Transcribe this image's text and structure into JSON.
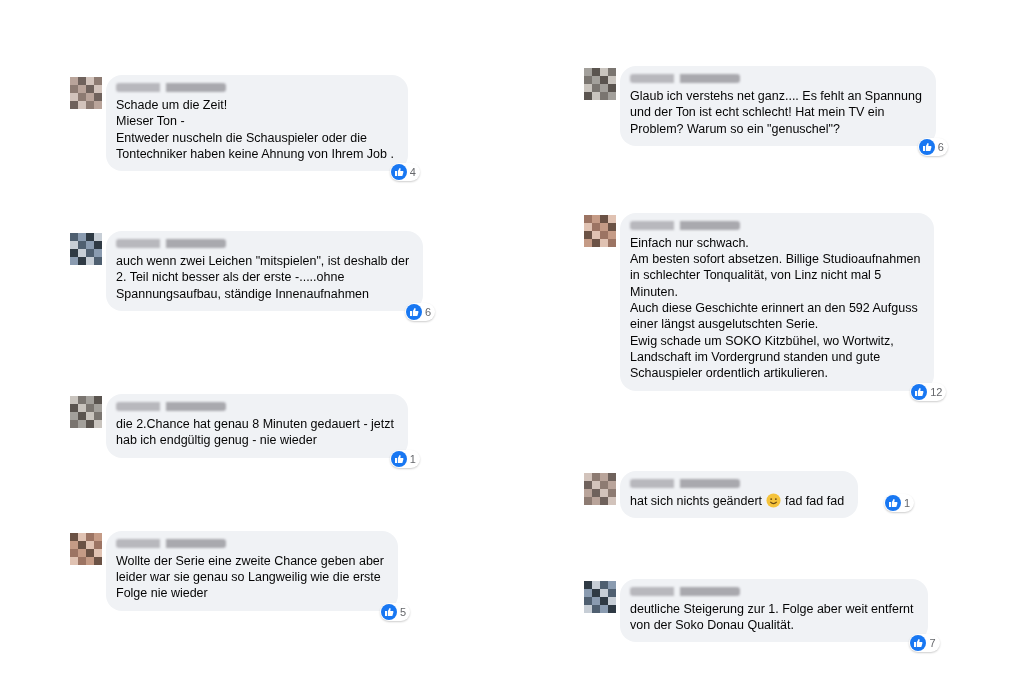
{
  "columns": [
    {
      "comments": [
        {
          "parts": [
            {
              "kind": "text",
              "text": "Schade um die Zeit!\nMieser Ton -\nEntweder nuscheln die Schauspieler oder die\nTontechniker haben keine Ahnung von Ihrem Job ."
            }
          ],
          "likes": "4"
        },
        {
          "parts": [
            {
              "kind": "text",
              "text": "auch wenn zwei Leichen \"mitspielen\", ist deshalb der\n2. Teil nicht besser als der erste -.....ohne\nSpannungsaufbau, ständige Innenaufnahmen"
            }
          ],
          "likes": "6"
        },
        {
          "parts": [
            {
              "kind": "text",
              "text": "die 2.Chance hat genau 8 Minuten gedauert - jetzt\nhab ich endgültig genug - nie wieder"
            }
          ],
          "likes": "1"
        },
        {
          "parts": [
            {
              "kind": "text",
              "text": "Wollte der Serie eine zweite Chance geben aber\nleider war sie genau so Langweilig wie die erste\nFolge nie wieder"
            }
          ],
          "likes": "5"
        }
      ]
    },
    {
      "comments": [
        {
          "parts": [
            {
              "kind": "text",
              "text": "Glaub ich verstehs net ganz.... Es fehlt an Spannung\nund der Ton ist echt schlecht! Hat mein TV ein\nProblem? Warum so ein \"genuschel\"?"
            }
          ],
          "likes": "6"
        },
        {
          "parts": [
            {
              "kind": "text",
              "text": "Einfach nur schwach.\nAm besten sofort absetzen. Billige Studioaufnahmen\nin schlechter Tonqualität, von Linz nicht mal 5\nMinuten.\nAuch diese Geschichte erinnert an den 592 Aufguss\neiner längst ausgelutschten Serie.\nEwig schade um SOKO Kitzbühel, wo Wortwitz,\nLandschaft im Vordergrund standen und gute\nSchauspieler ordentlich artikulieren."
            }
          ],
          "likes": "12"
        },
        {
          "parts": [
            {
              "kind": "text",
              "text": "hat sich nichts geändert"
            },
            {
              "kind": "smiley"
            },
            {
              "kind": "text",
              "text": "fad fad fad"
            }
          ],
          "likes": "1"
        },
        {
          "parts": [
            {
              "kind": "text",
              "text": "deutliche Steigerung zur 1. Folge aber weit entfernt\nvon der Soko Donau Qualität."
            }
          ],
          "likes": "7"
        }
      ]
    }
  ]
}
